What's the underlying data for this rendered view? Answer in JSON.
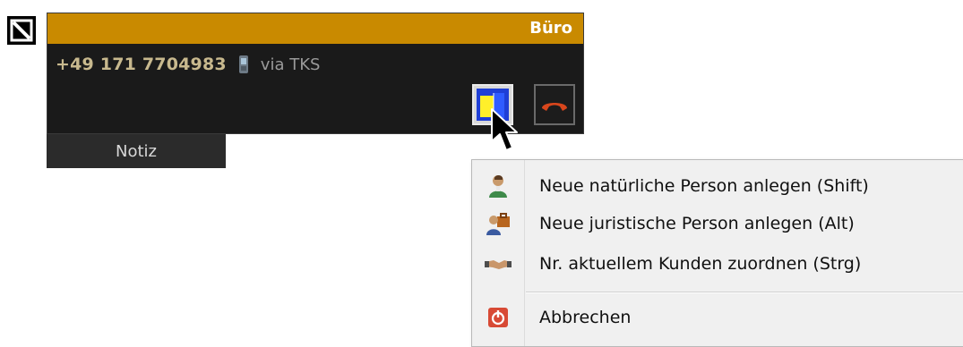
{
  "panel": {
    "title": "Büro",
    "caller_number": "+49 171 7704983",
    "via_label": "via TKS",
    "notiz_tab": "Notiz"
  },
  "icons": {
    "corner": "no-entry-square-icon",
    "phone": "mobile-phone-icon",
    "assign": "assign-contact-icon",
    "hangup": "hang-up-phone-icon",
    "cursor": "mouse-pointer-icon"
  },
  "context_menu": {
    "items": [
      {
        "label": "Neue natürliche Person anlegen (Shift)",
        "icon": "person-icon"
      },
      {
        "label": "Neue juristische Person anlegen (Alt)",
        "icon": "company-person-icon"
      },
      {
        "label": "Nr. aktuellem Kunden zuordnen (Strg)",
        "icon": "handshake-icon"
      },
      {
        "label": "Abbrechen",
        "icon": "cancel-icon"
      }
    ]
  },
  "colors": {
    "header": "#c98a00",
    "panel_bg": "#1a1a1a",
    "hangup_red": "#d8461c",
    "menu_bg": "#f0f0f0"
  }
}
